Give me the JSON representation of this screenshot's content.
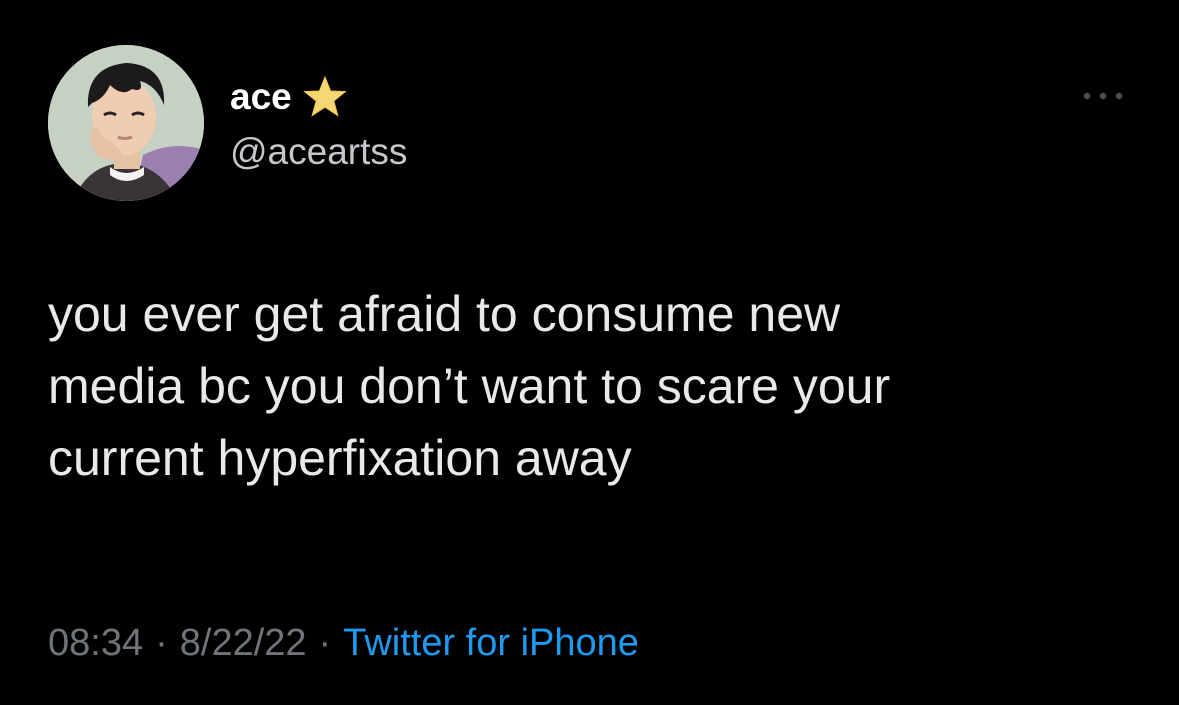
{
  "tweet": {
    "author": {
      "display_name": "ace",
      "handle": "@aceartss",
      "badge_icon": "star-icon"
    },
    "more_icon": "more-icon",
    "text": "you ever get afraid to consume new\nmedia bc you don’t want to scare your\ncurrent hyperfixation away",
    "meta": {
      "time": "08:34",
      "separator": "·",
      "date": "8/22/22",
      "source": "Twitter for iPhone"
    }
  },
  "colors": {
    "background": "#000000",
    "text": "#e9e9e9",
    "muted": "#6e7479",
    "link": "#1d9bf0",
    "star": "#f7d774"
  }
}
